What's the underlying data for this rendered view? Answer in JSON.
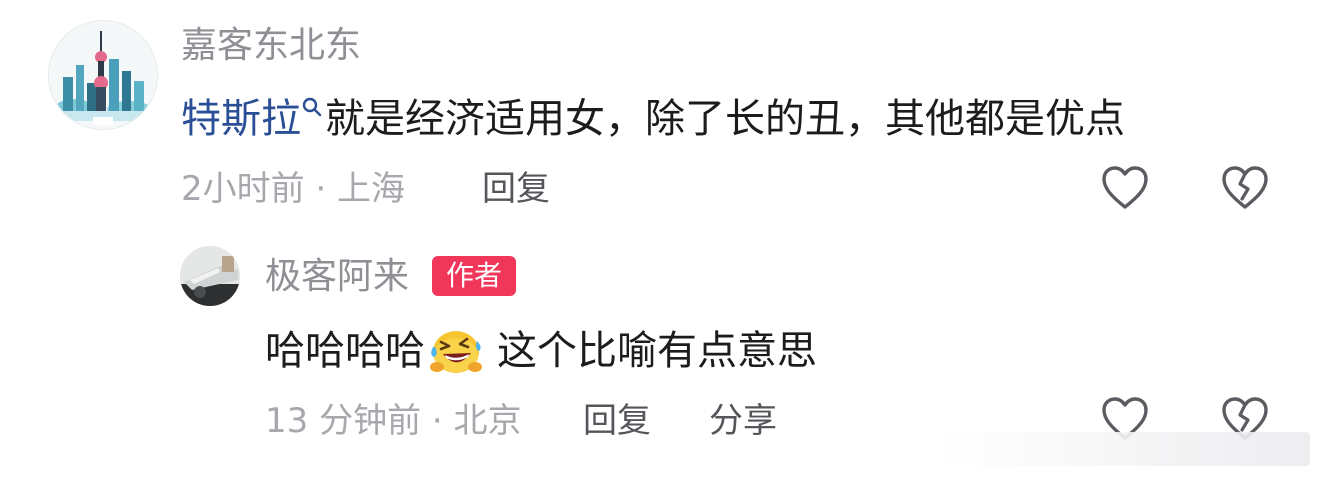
{
  "comments": [
    {
      "username": "嘉客东北东",
      "topic": "特斯拉",
      "text": "就是经济适用女，除了长的丑，其他都是优点",
      "meta": "2小时前 · 上海",
      "reply_label": "回复",
      "like_icon": "heart-outline-icon",
      "dislike_icon": "broken-heart-icon"
    },
    {
      "username": "极客阿来",
      "badge": "作者",
      "text_before": "哈哈哈哈",
      "emoji": "rolling-on-floor-laughing-emoji",
      "text_after": "这个比喻有点意思",
      "meta": "13 分钟前 · 北京",
      "reply_label": "回复",
      "share_label": "分享",
      "like_icon": "heart-outline-icon",
      "dislike_icon": "broken-heart-icon"
    }
  ],
  "colors": {
    "username": "#8f8f95",
    "topic_link": "#2a4f97",
    "badge_bg": "#f0375a",
    "meta": "#a7a7ad",
    "action": "#55555b"
  }
}
